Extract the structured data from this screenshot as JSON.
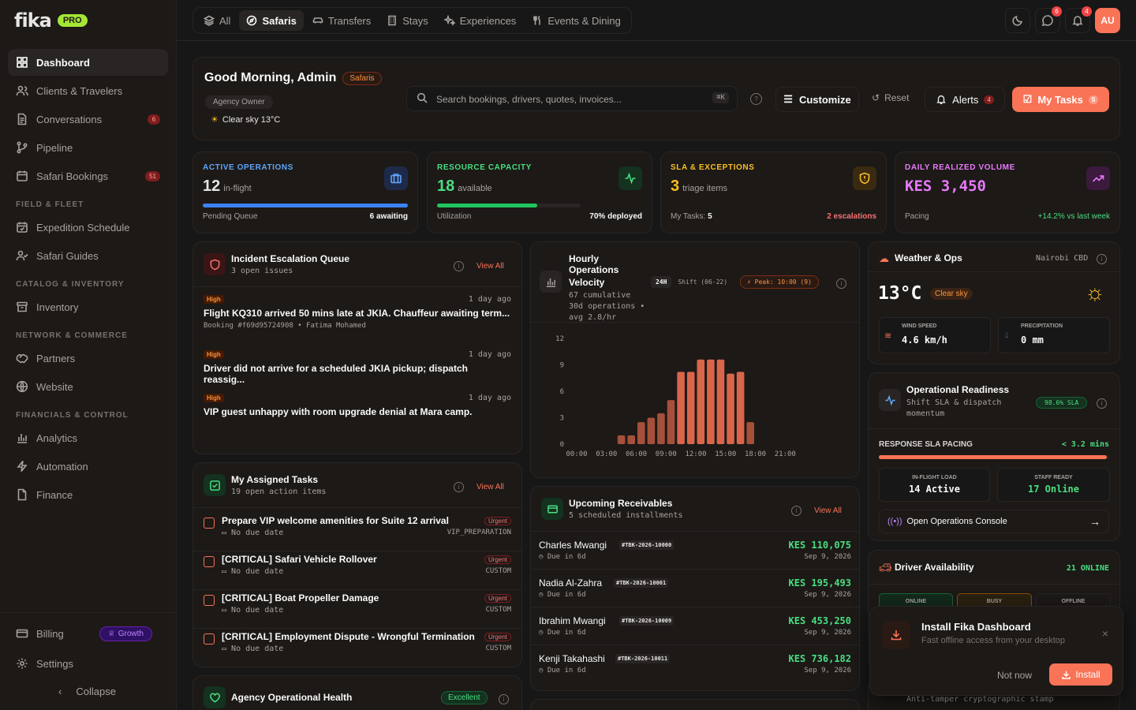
{
  "brand": {
    "name": "fika",
    "badge": "PRO"
  },
  "sidebar": {
    "items": [
      {
        "label": "Dashboard"
      },
      {
        "label": "Clients & Travelers"
      },
      {
        "label": "Conversations",
        "badge": "6"
      },
      {
        "label": "Pipeline"
      },
      {
        "label": "Safari Bookings",
        "badge": "51"
      },
      {
        "label": "Expedition Schedule"
      },
      {
        "label": "Safari Guides"
      },
      {
        "label": "Inventory"
      },
      {
        "label": "Partners"
      },
      {
        "label": "Website"
      },
      {
        "label": "Analytics"
      },
      {
        "label": "Automation"
      },
      {
        "label": "Finance"
      }
    ],
    "sections": [
      "FIELD & FLEET",
      "CATALOG & INVENTORY",
      "NETWORK & COMMERCE",
      "FINANCIALS & CONTROL"
    ],
    "billing": "Billing",
    "growth": "Growth",
    "settings": "Settings",
    "collapse": "Collapse"
  },
  "topnav": {
    "tabs": [
      "All",
      "Safaris",
      "Transfers",
      "Stays",
      "Experiences",
      "Events & Dining"
    ],
    "messages_count": "6",
    "notifications_count": "4",
    "avatar": "AU"
  },
  "greeting": {
    "title": "Good Morning, Admin",
    "tag": "Safaris",
    "role": "Agency Owner",
    "weather": "Clear sky 13°C",
    "search_placeholder": "Search bookings, drivers, quotes, invoices...",
    "shortcut": "⌘K",
    "customize": "Customize",
    "reset": "Reset",
    "alerts": "Alerts",
    "alerts_count": "4",
    "my_tasks": "My Tasks",
    "my_tasks_count": "5"
  },
  "stats": [
    {
      "label": "ACTIVE OPERATIONS",
      "value": "12",
      "unit": "in-flight",
      "foot_left": "Pending Queue",
      "foot_right": "6 awaiting",
      "progress": 1.0,
      "color": "#3b82f6"
    },
    {
      "label": "RESOURCE CAPACITY",
      "value": "18",
      "unit": "available",
      "foot_left": "Utilization",
      "foot_right": "70% deployed",
      "progress": 0.7,
      "color": "#22c55e"
    },
    {
      "label": "SLA & EXCEPTIONS",
      "value": "3",
      "unit": "triage items",
      "foot_left": "My Tasks:",
      "foot_left_b": "5",
      "foot_right": "2 escalations",
      "color": "#f59e0b"
    },
    {
      "label": "DAILY REALIZED VOLUME",
      "value": "KES 3,450",
      "foot_left": "Pacing",
      "foot_right": "+14.2% vs last week",
      "color": "#e879f9"
    }
  ],
  "incidents": {
    "title": "Incident Escalation Queue",
    "subtitle": "3 open issues",
    "view_all": "View All",
    "items": [
      {
        "severity": "High",
        "time": "1 day ago",
        "title": "Flight KQ310 arrived 50 mins late at JKIA. Chauffeur awaiting term...",
        "meta": "Booking #f69d95724908 • Fatima Mohamed"
      },
      {
        "severity": "High",
        "time": "1 day ago",
        "title": "Driver did not arrive for a scheduled JKIA pickup; dispatch reassig...",
        "meta": ""
      },
      {
        "severity": "High",
        "time": "1 day ago",
        "title": "VIP guest unhappy with room upgrade denial at Mara camp.",
        "meta": ""
      }
    ]
  },
  "velocity": {
    "title_1": "Hourly Operations",
    "title_2": "Velocity",
    "sub_1": "67 cumulative",
    "sub_2": "30d operations •",
    "sub_3": "avg 2.8/hr",
    "range": "24H",
    "shift": "Shift (06-22)",
    "peak": "Peak: 10:00 (9)"
  },
  "chart_data": {
    "type": "bar",
    "x_ticks": [
      "00:00",
      "03:00",
      "06:00",
      "09:00",
      "12:00",
      "15:00",
      "18:00",
      "21:00"
    ],
    "y_ticks": [
      "12",
      "9",
      "6",
      "3",
      "0"
    ],
    "ylim": [
      0,
      12
    ],
    "categories": [
      "00:00",
      "01:00",
      "02:00",
      "03:00",
      "04:00",
      "05:00",
      "06:00",
      "07:00",
      "08:00",
      "09:00",
      "10:00",
      "11:00",
      "12:00",
      "13:00",
      "14:00",
      "15:00",
      "16:00",
      "17:00",
      "18:00",
      "19:00",
      "20:00",
      "21:00",
      "22:00",
      "23:00"
    ],
    "values": [
      0,
      0,
      0,
      0,
      1,
      1,
      2.5,
      3,
      3.5,
      5,
      8.2,
      8.2,
      9.6,
      9.6,
      9.6,
      8,
      8.2,
      2.5,
      0,
      0,
      0,
      0,
      0,
      0
    ]
  },
  "tasks": {
    "title": "My Assigned Tasks",
    "subtitle": "19 open action items",
    "view_all": "View All",
    "items": [
      {
        "title": "Prepare VIP welcome amenities for Suite 12 arrival",
        "tag": "Urgent",
        "due": "No due date",
        "type": "VIP_PREPARATION"
      },
      {
        "title": "[CRITICAL] Safari Vehicle Rollover",
        "tag": "Urgent",
        "due": "No due date",
        "type": "CUSTOM"
      },
      {
        "title": "[CRITICAL] Boat Propeller Damage",
        "tag": "Urgent",
        "due": "No due date",
        "type": "CUSTOM"
      },
      {
        "title": "[CRITICAL] Employment Dispute - Wrongful Termination",
        "tag": "Urgent",
        "due": "No due date",
        "type": "CUSTOM"
      }
    ]
  },
  "health": {
    "title": "Agency Operational Health",
    "status": "Excellent"
  },
  "receivables": {
    "title": "Upcoming Receivables",
    "subtitle": "5 scheduled installments",
    "view_all": "View All",
    "items": [
      {
        "name": "Charles Mwangi",
        "ref": "#TBK-2026-10000",
        "due": "Due in 6d",
        "amount": "KES 110,075",
        "date": "Sep 9, 2026"
      },
      {
        "name": "Nadia Al-Zahra",
        "ref": "#TBK-2026-10001",
        "due": "Due in 6d",
        "amount": "KES 195,493",
        "date": "Sep 9, 2026"
      },
      {
        "name": "Ibrahim Mwangi",
        "ref": "#TBK-2026-10009",
        "due": "Due in 6d",
        "amount": "KES 453,250",
        "date": "Sep 9, 2026"
      },
      {
        "name": "Kenji Takahashi",
        "ref": "#TBK-2026-10011",
        "due": "Due in 6d",
        "amount": "KES 736,182",
        "date": "Sep 9, 2026"
      }
    ]
  },
  "weather": {
    "title": "Weather & Ops",
    "location": "Nairobi CBD",
    "temp": "13°C",
    "condition": "Clear sky",
    "wind_label": "WIND SPEED",
    "wind": "4.6 km/h",
    "precip_label": "PRECIPITATION",
    "precip": "0 mm"
  },
  "readiness": {
    "title": "Operational Readiness",
    "sub_1": "Shift SLA & dispatch",
    "sub_2": "momentum",
    "sla_badge": "98.6% SLA",
    "pacing_label": "RESPONSE SLA PACING",
    "pacing_value": "< 3.2 mins",
    "pacing_progress": 0.99,
    "load_label": "IN-FLIGHT LOAD",
    "load_value": "14 Active",
    "staff_label": "STAFF READY",
    "staff_value": "17 Online",
    "console": "Open Operations Console"
  },
  "drivers": {
    "title": "Driver Availability",
    "online_count": "21 ONLINE",
    "tabs": [
      "ONLINE",
      "BUSY",
      "OFFLINE"
    ],
    "footer_text": "Anti-tamper cryptographic stamp"
  },
  "install": {
    "title": "Install Fika Dashboard",
    "subtitle": "Fast offline access from your desktop",
    "not_now": "Not now",
    "install": "Install"
  }
}
